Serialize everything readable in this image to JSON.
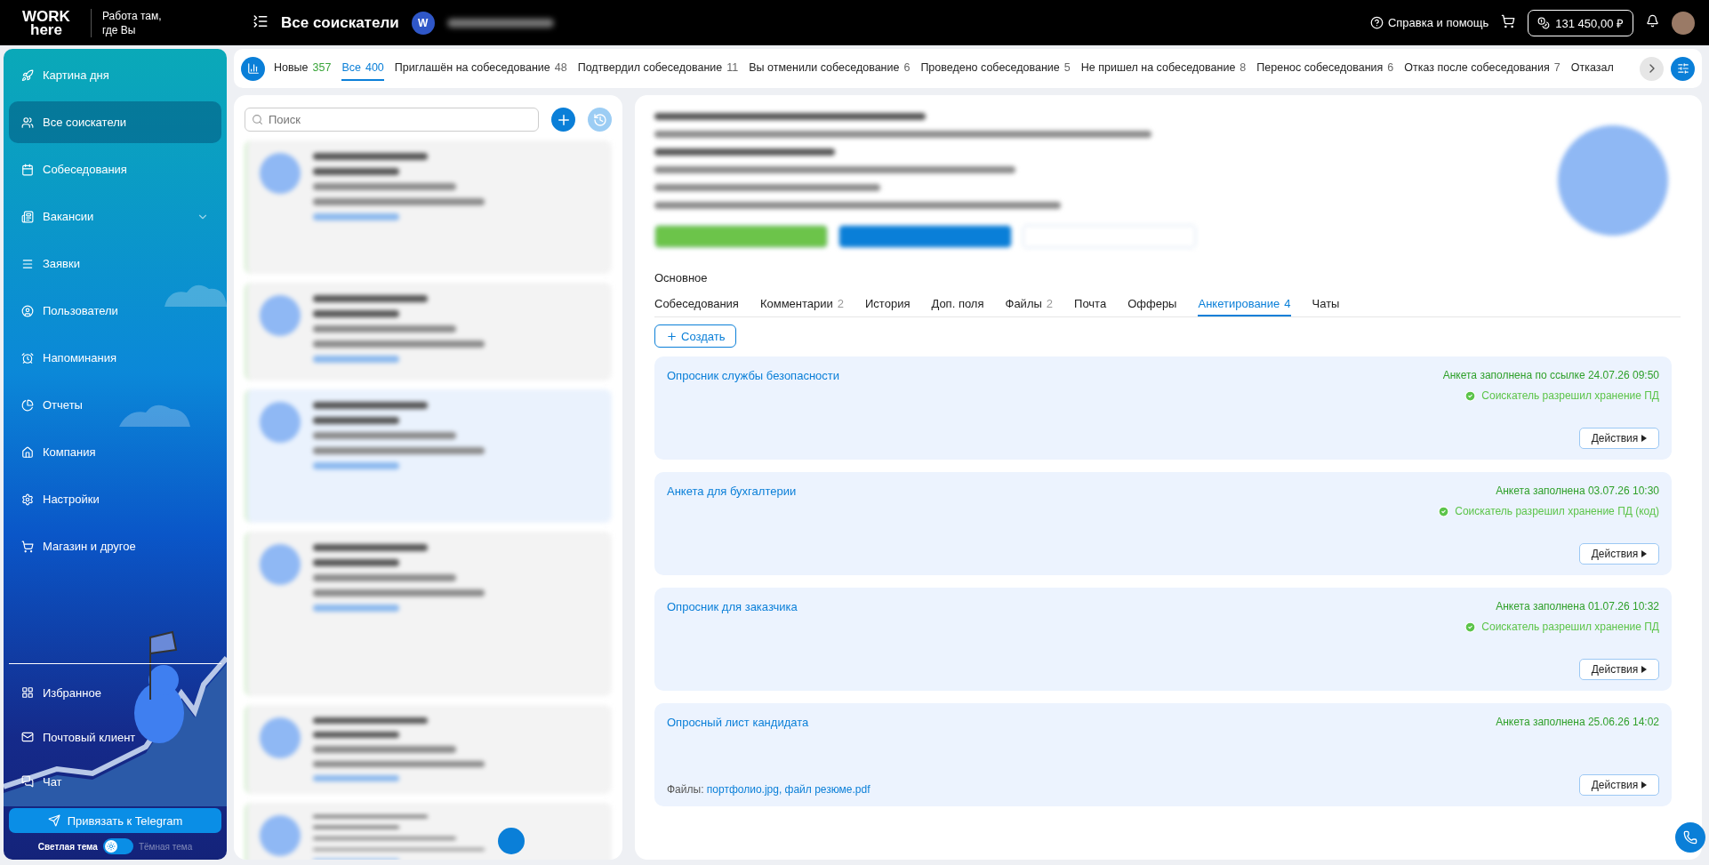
{
  "topbar": {
    "logo_top": "WORK",
    "logo_bottom": "here",
    "tagline": [
      "Работа там,",
      "где Вы"
    ],
    "page_title": "Все соискатели",
    "user_initials": "W",
    "help": "Справка и помощь",
    "balance": "131 450,00 ₽"
  },
  "status_tabs": [
    {
      "label": "Новые",
      "count": "357",
      "selected": false
    },
    {
      "label": "Все",
      "count": "400",
      "selected": true
    },
    {
      "label": "Приглашён на собеседование",
      "count": "48",
      "selected": false
    },
    {
      "label": "Подтвердил собеседование",
      "count": "11",
      "selected": false
    },
    {
      "label": "Вы отменили собеседование",
      "count": "6",
      "selected": false
    },
    {
      "label": "Проведено собеседование",
      "count": "5",
      "selected": false
    },
    {
      "label": "Не пришел на собеседование",
      "count": "8",
      "selected": false
    },
    {
      "label": "Перенос собеседования",
      "count": "6",
      "selected": false
    },
    {
      "label": "Отказ после собеседования",
      "count": "7",
      "selected": false
    },
    {
      "label": "Отказал",
      "selected": false
    }
  ],
  "sidebar": {
    "items": [
      {
        "label": "Картина дня",
        "selected": false
      },
      {
        "label": "Все соискатели",
        "selected": true
      },
      {
        "label": "Собеседования",
        "selected": false
      },
      {
        "label": "Вакансии",
        "selected": false,
        "expanded": false
      },
      {
        "label": "Заявки",
        "selected": false
      },
      {
        "label": "Пользователи",
        "selected": false
      },
      {
        "label": "Напоминания",
        "selected": false
      },
      {
        "label": "Отчеты",
        "selected": false
      },
      {
        "label": "Компания",
        "selected": false
      },
      {
        "label": "Настройки",
        "selected": false
      },
      {
        "label": "Магазин и другое",
        "selected": false
      }
    ],
    "bottom_items": [
      {
        "label": "Избранное",
        "selected": false
      },
      {
        "label": "Почтовый клиент",
        "selected": false
      },
      {
        "label": "Чат",
        "selected": false
      }
    ],
    "telegram_button": "Привязать к Telegram",
    "theme": {
      "light_label": "Светлая тема",
      "dark_label": "Тёмная тема",
      "dark": false
    }
  },
  "search": {
    "placeholder": "Поиск"
  },
  "detail": {
    "section": "Основное",
    "tabs": [
      {
        "label": "Собеседования",
        "selected": false
      },
      {
        "label": "Комментарии",
        "count": "2",
        "selected": false
      },
      {
        "label": "История",
        "selected": false
      },
      {
        "label": "Доп. поля",
        "selected": false
      },
      {
        "label": "Файлы",
        "count": "2",
        "selected": false
      },
      {
        "label": "Почта",
        "selected": false
      },
      {
        "label": "Офферы",
        "selected": false
      },
      {
        "label": "Анкетирование",
        "count": "4",
        "selected": true
      },
      {
        "label": "Чаты",
        "selected": false
      }
    ],
    "create_button": "Создать",
    "questionnaires": [
      {
        "title": "Опросник службы безопасности",
        "status": "Анкета заполнена по ссылке 24.07.26 09:50",
        "consent": "Соискатель разрешил хранение ПД",
        "action": "Действия"
      },
      {
        "title": "Анкета для бухгалтерии",
        "status": "Анкета заполнена 03.07.26 10:30",
        "consent": "Соискатель разрешил хранение ПД (код)",
        "action": "Действия"
      },
      {
        "title": "Опросник для заказчика",
        "status": "Анкета заполнена 01.07.26 10:32",
        "consent": "Соискатель разрешил хранение ПД",
        "action": "Действия"
      },
      {
        "title": "Опросный лист кандидата",
        "status": "Анкета заполнена 25.06.26 14:02",
        "files_label": "Файлы:",
        "files": "портфолио.jpg, файл резюме.pdf",
        "action": "Действия"
      }
    ]
  }
}
